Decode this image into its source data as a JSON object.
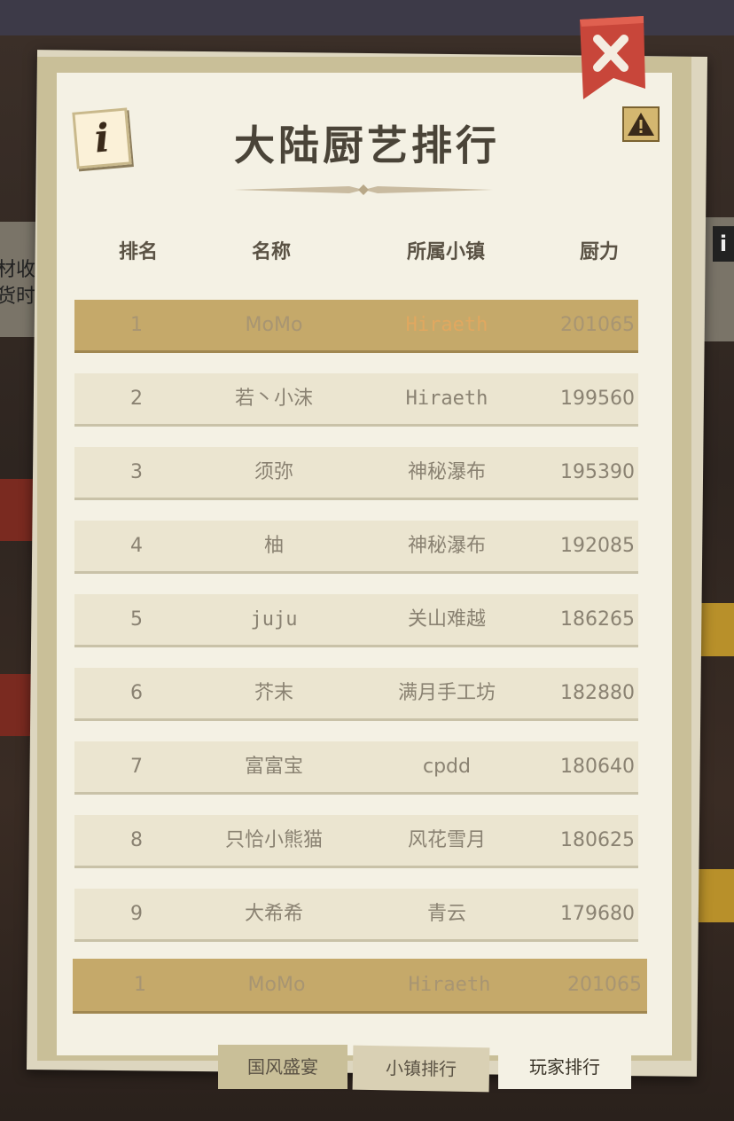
{
  "title": "大陆厨艺排行",
  "background": {
    "left_sign_lines": [
      "材收",
      "货时"
    ],
    "right_sign_icon": "info-icon"
  },
  "headers": {
    "rank": "排名",
    "name": "名称",
    "town": "所属小镇",
    "power": "厨力"
  },
  "rows": [
    {
      "rank": "1",
      "name": "MoMo",
      "town": "Hiraeth",
      "power": "201065",
      "highlight": true
    },
    {
      "rank": "2",
      "name": "若丶小沫",
      "town": "Hiraeth",
      "power": "199560"
    },
    {
      "rank": "3",
      "name": "须弥",
      "town": "神秘瀑布",
      "power": "195390"
    },
    {
      "rank": "4",
      "name": "柚",
      "town": "神秘瀑布",
      "power": "192085"
    },
    {
      "rank": "5",
      "name": "juju",
      "town": "关山难越",
      "power": "186265"
    },
    {
      "rank": "6",
      "name": "芥末",
      "town": "满月手工坊",
      "power": "182880"
    },
    {
      "rank": "7",
      "name": "富富宝",
      "town": "cpdd",
      "power": "180640"
    },
    {
      "rank": "8",
      "name": "只恰小熊猫",
      "town": "风花雪月",
      "power": "180625"
    },
    {
      "rank": "9",
      "name": "大希希",
      "town": "青云",
      "power": "179680"
    }
  ],
  "self_row": {
    "rank": "1",
    "name": "MoMo",
    "town": "Hiraeth",
    "power": "201065"
  },
  "tabs": {
    "tab1": "国风盛宴",
    "tab2": "小镇排行",
    "tab3": "玩家排行",
    "active": "玩家排行"
  },
  "icons": {
    "info": "info-icon",
    "warning": "warning-icon",
    "close": "close-icon"
  },
  "colors": {
    "highlight_row": "#c5a96a",
    "highlight_town": "#e0a860",
    "close_ribbon": "#c8463a"
  }
}
